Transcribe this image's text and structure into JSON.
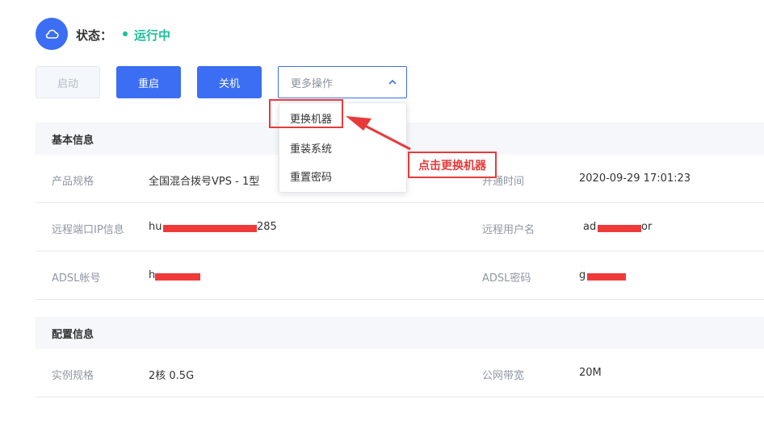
{
  "status": {
    "label": "状态：",
    "value": "运行中",
    "icon": "cloud-icon",
    "color": "#1bbf9a"
  },
  "buttons": {
    "start": "启动",
    "restart": "重启",
    "shutdown": "关机",
    "more_placeholder": "更多操作"
  },
  "dropdown": {
    "items": [
      "更换机器",
      "重装系统",
      "重置密码"
    ]
  },
  "annotation": {
    "text": "点击更换机器"
  },
  "basic_info": {
    "title": "基本信息",
    "rows": [
      {
        "label_left": "产品规格",
        "value_left": "全国混合拨号VPS - 1型",
        "label_right": "开通时间",
        "value_right": "2020-09-29 17:01:23"
      },
      {
        "label_left": "远程端口IP信息",
        "value_left_prefix": "hu",
        "value_left_suffix": "285",
        "label_right": "远程用户名",
        "value_right_prefix": "ad",
        "value_right_suffix": "or"
      },
      {
        "label_left": "ADSL帐号",
        "value_left_prefix": "h",
        "value_left_suffix": "",
        "label_right": "ADSL密码",
        "value_right_prefix": "g",
        "value_right_suffix": ""
      }
    ]
  },
  "config_info": {
    "title": "配置信息",
    "rows": [
      {
        "label_left": "实例规格",
        "value_left": "2核 0.5G",
        "label_right": "公网带宽",
        "value_right": "20M"
      }
    ]
  },
  "colors": {
    "primary": "#3b6ef2",
    "running": "#1bbf9a",
    "annotation_red": "#e83a3a"
  }
}
